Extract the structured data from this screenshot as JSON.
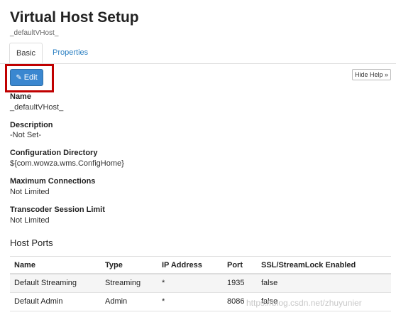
{
  "header": {
    "title": "Virtual Host Setup",
    "subtitle": "_defaultVHost_"
  },
  "tabs": [
    {
      "label": "Basic",
      "active": true
    },
    {
      "label": "Properties",
      "active": false
    }
  ],
  "toolbar": {
    "edit_label": "Edit",
    "edit_icon": "pencil-icon",
    "help_label": "Hide Help »"
  },
  "fields": {
    "name": {
      "label": "Name",
      "value": "_defaultVHost_"
    },
    "description": {
      "label": "Description",
      "value": "-Not Set-"
    },
    "config_dir": {
      "label": "Configuration Directory",
      "value": "${com.wowza.wms.ConfigHome}"
    },
    "max_connections": {
      "label": "Maximum Connections",
      "value": "Not Limited"
    },
    "transcoder_limit": {
      "label": "Transcoder Session Limit",
      "value": "Not Limited"
    }
  },
  "host_ports": {
    "title": "Host Ports",
    "columns": [
      "Name",
      "Type",
      "IP Address",
      "Port",
      "SSL/StreamLock Enabled"
    ],
    "rows": [
      [
        "Default Streaming",
        "Streaming",
        "*",
        "1935",
        "false"
      ],
      [
        "Default Admin",
        "Admin",
        "*",
        "8086",
        "false"
      ]
    ]
  },
  "watermark": "https://blog.csdn.net/zhuyunier",
  "colors": {
    "accent": "#3a87d0",
    "link": "#2a7fc2",
    "highlight": "#c00000"
  }
}
